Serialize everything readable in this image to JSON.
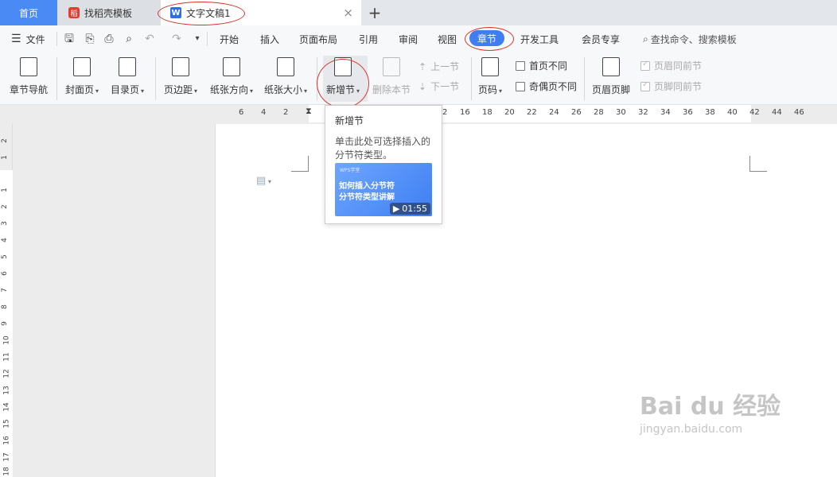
{
  "tabs": {
    "home": "首页",
    "template": "找稻壳模板",
    "document": "文字文稿1",
    "template_badge": "稻",
    "doc_badge": "W",
    "add": "+",
    "close": "×"
  },
  "menu": {
    "file": "文件",
    "items": [
      "开始",
      "插入",
      "页面布局",
      "引用",
      "审阅",
      "视图",
      "章节",
      "开发工具",
      "会员专享"
    ],
    "search_placeholder": "查找命令、搜索模板"
  },
  "ribbon": {
    "nav": "章节导航",
    "cover": "封面页",
    "toc": "目录页",
    "margin": "页边距",
    "orientation": "纸张方向",
    "size": "纸张大小",
    "new_section": "新增节",
    "delete_section": "删除本节",
    "prev_section": "上一节",
    "next_section": "下一节",
    "page_number": "页码",
    "first_page_diff": "首页不同",
    "odd_even_diff": "奇偶页不同",
    "header_footer": "页眉页脚",
    "header_same_prev": "页眉同前节",
    "footer_same_prev": "页脚同前节"
  },
  "tooltip": {
    "title": "新增节",
    "desc": "单击此处可选择插入的分节符类型。",
    "video_brand": "WPS学堂",
    "video_title_1": "如何插入分节符",
    "video_title_2": "分节符类型讲解",
    "duration": "01:55"
  },
  "ruler": {
    "h_left": [
      "6",
      "4",
      "2"
    ],
    "h_right": [
      "2",
      "16",
      "18",
      "20",
      "22",
      "24",
      "26",
      "28",
      "30",
      "32",
      "34",
      "36",
      "38",
      "40",
      "42",
      "44",
      "46"
    ],
    "v": [
      "2",
      "1",
      "1",
      "2",
      "3",
      "4",
      "5",
      "6",
      "7",
      "8",
      "9",
      "10",
      "11",
      "12",
      "13",
      "14",
      "15",
      "16",
      "17",
      "18"
    ]
  },
  "watermark": {
    "brand": "Bai du 经验",
    "url": "jingyan.baidu.com"
  },
  "colors": {
    "accent": "#3f7df0",
    "highlight_ring": "#d9342b"
  }
}
